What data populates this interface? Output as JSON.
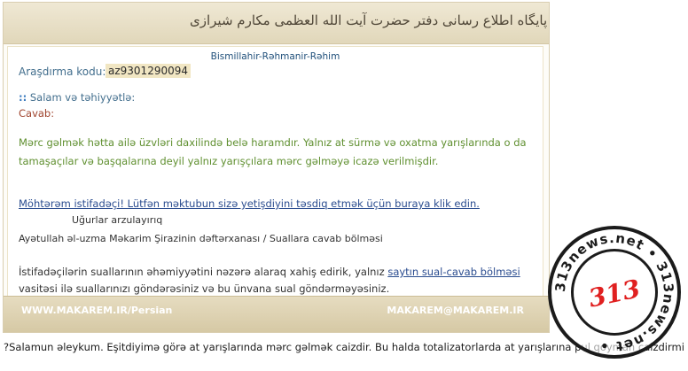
{
  "banner": {
    "script_text": "پایگاه اطلاع رسانی دفتر حضرت آیت الله العظمی مکارم شیرازی"
  },
  "header": {
    "bismillah": "Bismillahir-Rəhmanir-Rəhim"
  },
  "reference": {
    "label": "Araşdırma kodu:",
    "code": "az9301290094"
  },
  "letter": {
    "greeting_marker": "::",
    "greeting": "Salam və təhiyyətlə:",
    "answer_label": "Cavab:",
    "answer_text": "Mərc gəlmək hətta ailə üzvləri daxilində belə haramdır. Yalnız at sürmə və oxatma yarışlarında o da tamaşaçılar və başqalarına deyil yalnız yarışçılara mərc gəlməyə icazə verilmişdir.",
    "confirm_link": "Möhtərəm istifadəçi! Lütfən məktubun sizə yetişdiyini təsdiq etmək üçün buraya klik edin.",
    "wishes": "Uğurlar arzulayırıq",
    "office": "Ayətullah əl-uzma Məkarim Şirazinin dəftərxanası / Suallara cavab bölməsi",
    "notice_before": "İstifadəçilərin suallarının əhəmiyyətini nəzərə alaraq xahiş edirik, yalnız ",
    "notice_link": "saytın sual-cavab bölməsi",
    "notice_after": " vasitəsi ilə suallarınızı göndərəsiniz və bu ünvana sual göndərməyəsiniz."
  },
  "footer": {
    "left": "WWW.MAKAREM.IR/Persian",
    "right": "MAKAREM@MAKAREM.IR"
  },
  "question": "?Salamun əleykum. Eşitdiyimə görə at yarışlarında mərc gəlmək caizdir. Bu halda totalizatorlarda at yarışlarına pul qoyman caizdirmi",
  "stamp": {
    "ring_text": "313news.net • 313news.net •",
    "number": "313",
    "number_color": "#e02020"
  }
}
